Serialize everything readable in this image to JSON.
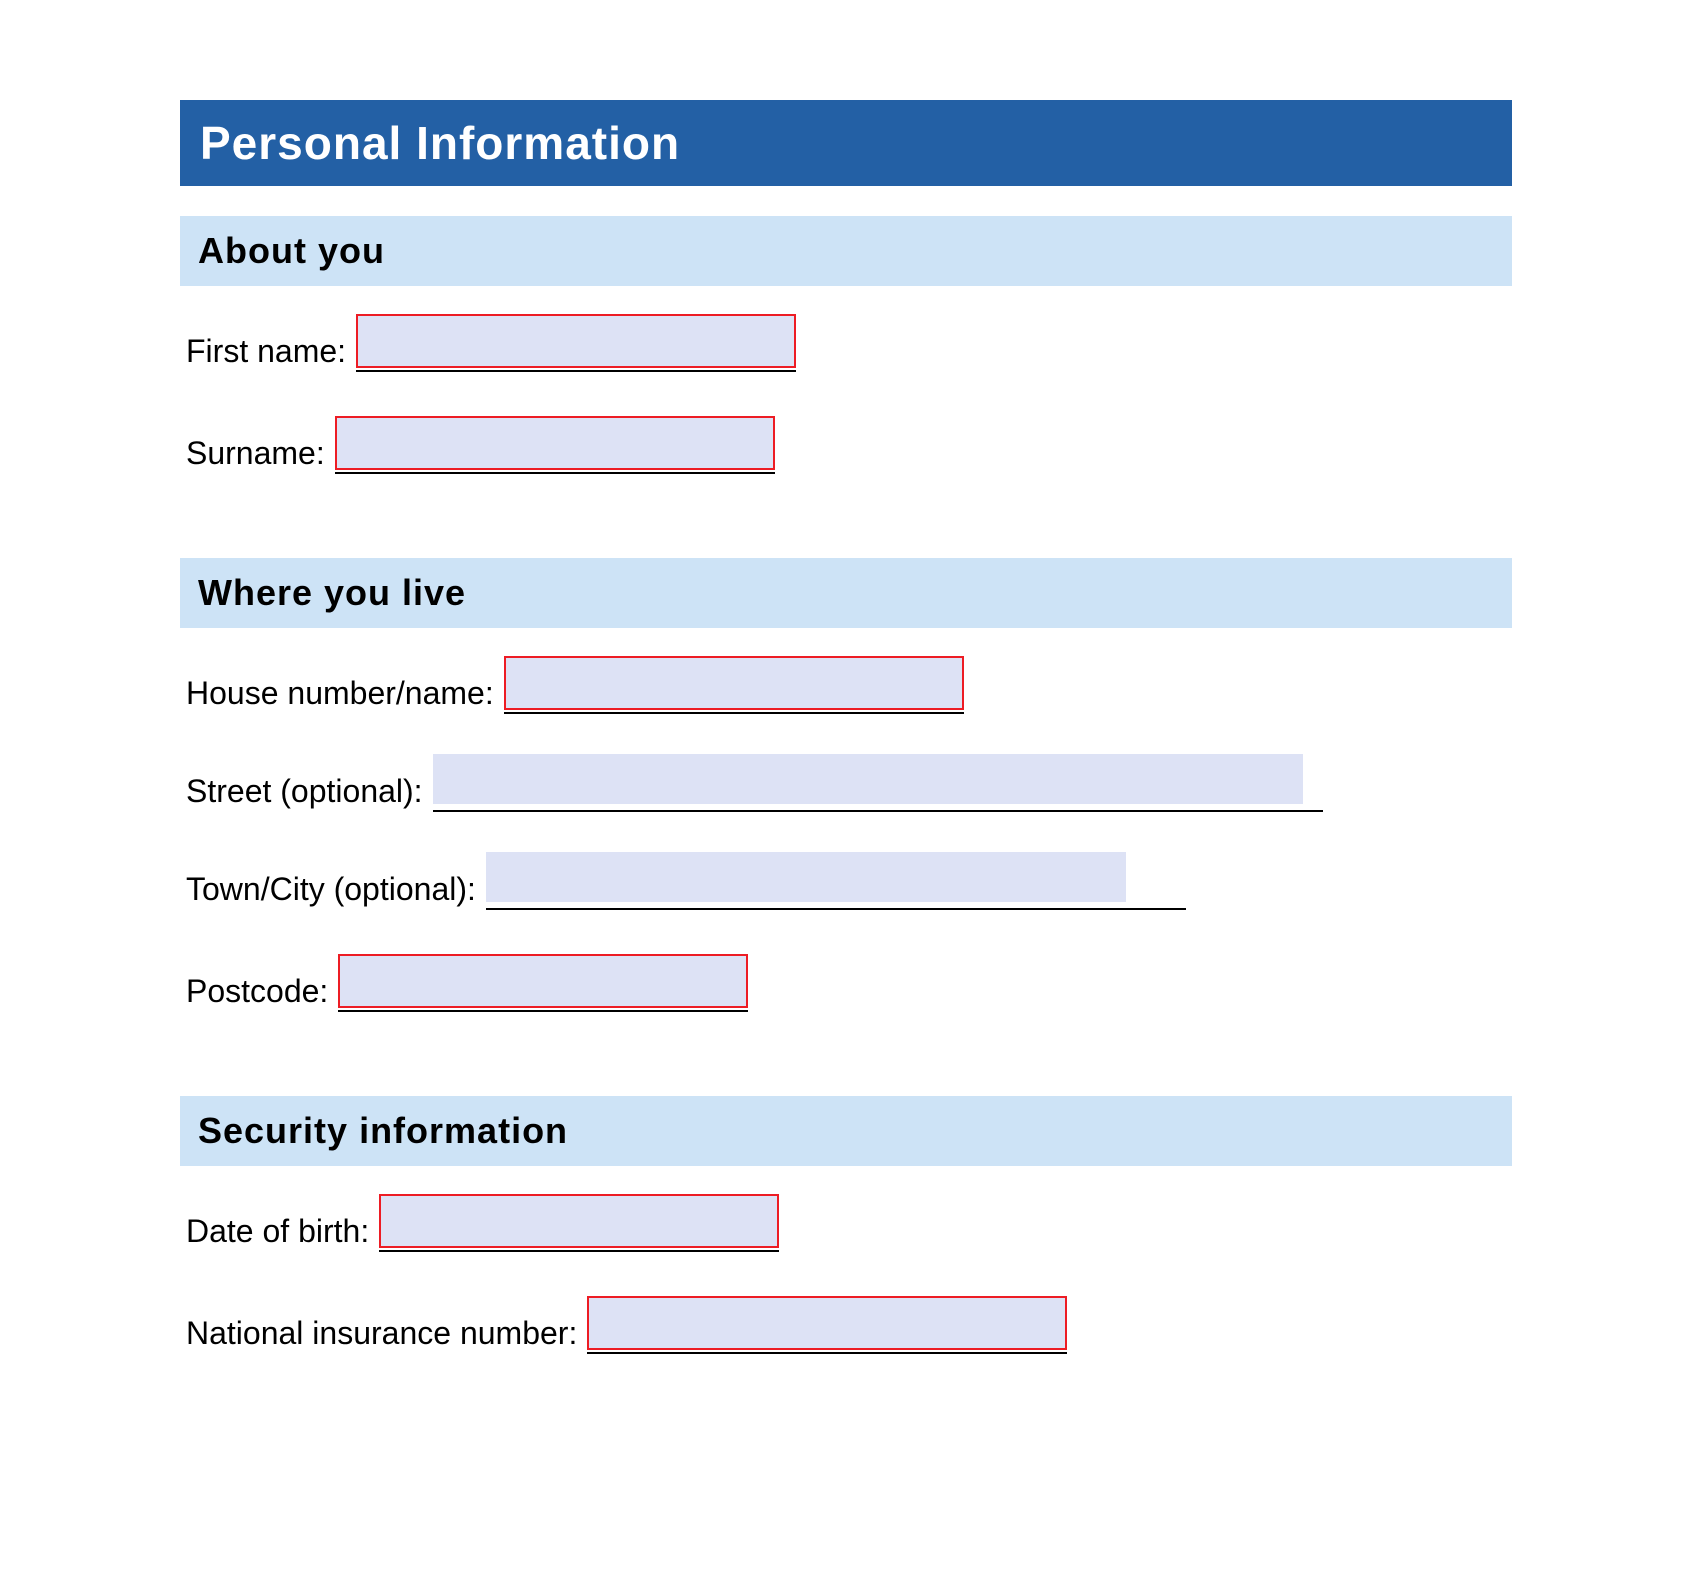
{
  "title": "Personal Information",
  "sections": {
    "about_you": {
      "header": "About you",
      "first_name_label": "First name:",
      "first_name_value": "",
      "surname_label": "Surname:",
      "surname_value": ""
    },
    "where_you_live": {
      "header": "Where you live",
      "house_label": "House number/name:",
      "house_value": "",
      "street_label": "Street (optional):",
      "street_value": "",
      "town_label": "Town/City (optional):",
      "town_value": "",
      "postcode_label": "Postcode:",
      "postcode_value": ""
    },
    "security": {
      "header": "Security information",
      "dob_label": "Date of birth:",
      "dob_value": "",
      "ni_label": "National insurance number:",
      "ni_value": ""
    }
  }
}
